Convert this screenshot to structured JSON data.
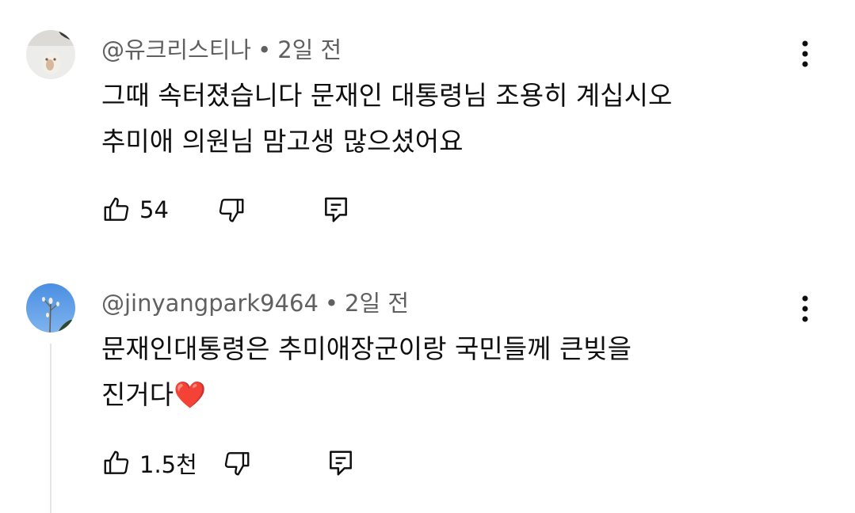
{
  "comments": [
    {
      "author": "@유크리스티나",
      "separator": "•",
      "time": "2일 전",
      "lines": [
        "그때 속터졌습니다 문재인 대통령님 조용히 계십시오",
        "추미애 의원님 맘고생 많으셨어요"
      ],
      "likes": "54"
    },
    {
      "author": "@jinyangpark9464",
      "separator": "•",
      "time": "2일 전",
      "lines": [
        "문재인대통령은 추미애장군이랑 국민들께 큰빚을",
        "진거다"
      ],
      "emoji": "❤️",
      "likes": "1.5천"
    }
  ],
  "icons": {
    "like": "thumbs-up-icon",
    "dislike": "thumbs-down-icon",
    "reply": "reply-icon",
    "more": "more-vert-icon"
  },
  "colors": {
    "text": "#0f0f0f",
    "meta": "#606060",
    "thread_line": "#e5e5e5",
    "heart": "#e0202a"
  }
}
